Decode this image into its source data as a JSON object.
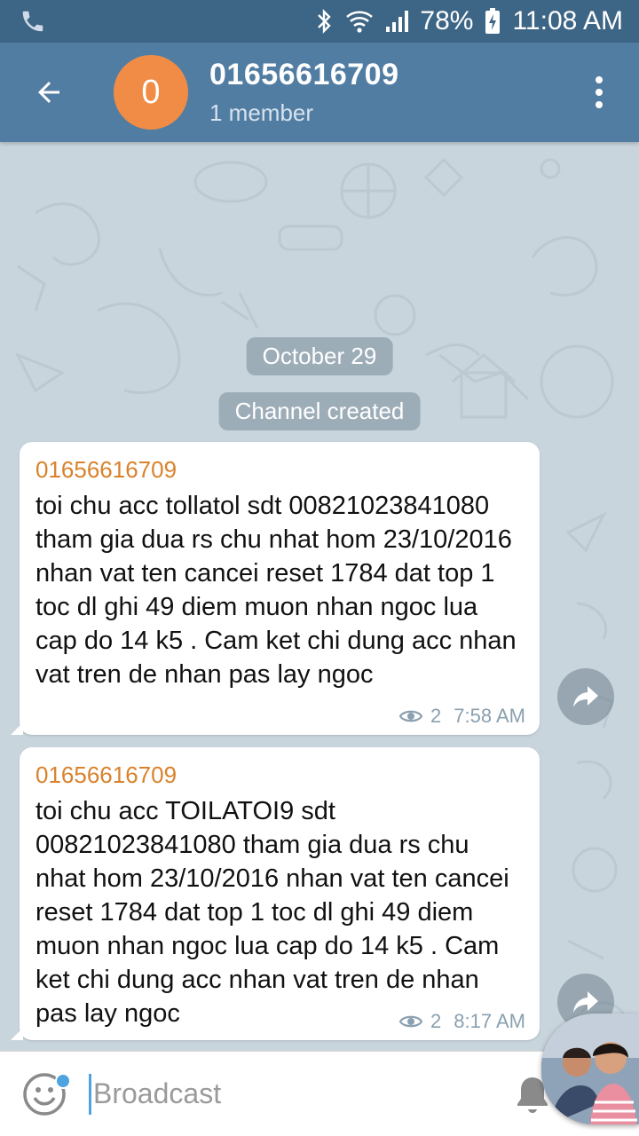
{
  "status_bar": {
    "battery": "78%",
    "time": "11:08 AM",
    "icons": [
      "phone-icon",
      "bluetooth-icon",
      "wifi-icon",
      "signal-icon",
      "battery-charging-icon"
    ]
  },
  "header": {
    "avatar_letter": "0",
    "avatar_color": "#f08c45",
    "title": "01656616709",
    "subtitle": "1 member",
    "bar_color": "#527da3"
  },
  "chat": {
    "date_pill": "October 29",
    "service_message": "Channel created",
    "messages": [
      {
        "author": "01656616709",
        "text": "toi chu acc tollatol sdt 00821023841080 tham gia dua rs chu nhat hom 23/10/2016 nhan vat ten cancei reset 1784 dat top 1 toc dl ghi 49 diem muon nhan ngoc lua cap do 14 k5 . Cam ket chi dung acc nhan vat tren de nhan pas lay ngoc",
        "views": "2",
        "time": "7:58 AM"
      },
      {
        "author": "01656616709",
        "text": "toi chu acc TOILATOI9 sdt 00821023841080 tham gia dua rs chu nhat hom 23/10/2016 nhan vat ten cancei reset 1784 dat top 1 toc dl ghi 49 diem muon nhan ngoc lua cap do 14 k5 . Cam ket chi dung acc nhan vat tren de nhan pas lay ngoc",
        "views": "2",
        "time": "8:17 AM"
      }
    ]
  },
  "composer": {
    "placeholder": "Broadcast"
  }
}
